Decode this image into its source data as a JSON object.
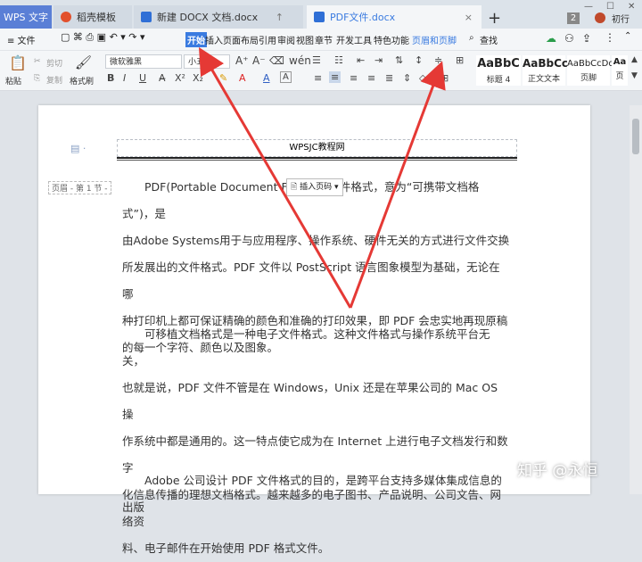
{
  "tabs": {
    "app": "WPS 文字",
    "template": "稻壳模板",
    "doc1": "新建 DOCX 文档.docx",
    "pdf": "PDF文件.docx",
    "close": "×",
    "plus": "+"
  },
  "titlebar": {
    "badge": "2",
    "user": "初行"
  },
  "menu": {
    "file": "≡ 文件",
    "items": [
      "开始",
      "插入",
      "页面布局",
      "引用",
      "审阅",
      "视图",
      "章节",
      "开发工具",
      "特色功能",
      "页眉和页脚"
    ],
    "search": "查找"
  },
  "toolbar": {
    "paste": "粘贴",
    "cut": "剪切",
    "copy": "复制",
    "format_painter": "格式刷",
    "font": "微软雅黑",
    "size": "小五",
    "bold": "B",
    "italic": "I",
    "underline": "U",
    "styles": [
      {
        "sample": "AaBbC",
        "label": "标题 4"
      },
      {
        "sample": "AaBbCc",
        "label": "正文文本"
      },
      {
        "sample": "AaBbCcDd",
        "label": "页脚"
      }
    ],
    "more_style_label": "页"
  },
  "page": {
    "header_text": "WPSJC教程网",
    "header_label": "页眉 - 第 1 节 -",
    "insert_page_number": "插入页码",
    "paragraphs": [
      {
        "lines": [
          "PDF(Portable Document Format) 文件格式，意为“可携带文档格式”)，是",
          "由Adobe Systems用于与应用程序、操作系统、硬件无关的方式进行文件交换",
          "所发展出的文件格式。PDF 文件以 PostScript 语言图象模型为基础，无论在哪",
          "种打印机上都可保证精确的颜色和准确的打印效果，即 PDF 会忠实地再现原稿",
          "的每一个字符、颜色以及图象。"
        ]
      },
      {
        "lines": [
          "可移植文档格式是一种电子文件格式。这种文件格式与操作系统平台无关，",
          "也就是说，PDF 文件不管是在 Windows，Unix 还是在苹果公司的 Mac OS 操",
          "作系统中都是通用的。这一特点使它成为在 Internet 上进行电子文档发行和数字",
          "化信息传播的理想文档格式。越来越多的电子图书、产品说明、公司文告、网络资",
          "料、电子邮件在开始使用 PDF 格式文件。"
        ]
      },
      {
        "lines": [
          "Adobe 公司设计 PDF 文件格式的目的，是跨平台支持多媒体集成信息的出版"
        ]
      }
    ]
  },
  "watermark": "知乎 @永恒",
  "colors": {
    "accent": "#3a7be0",
    "arrow": "#e53935",
    "tab_app": "#5a7fd6"
  }
}
